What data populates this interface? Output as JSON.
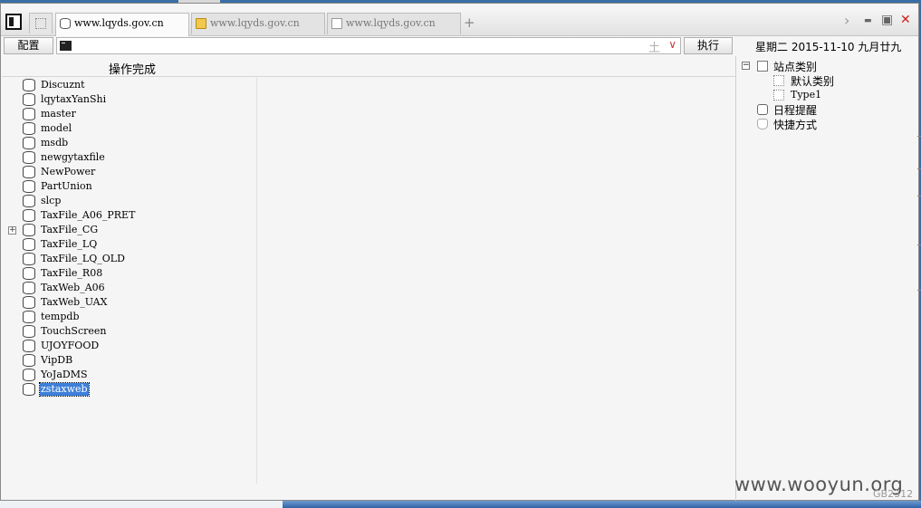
{
  "tabs": [
    {
      "title": "www.lqyds.gov.cn",
      "icon": "database-icon",
      "active": true
    },
    {
      "title": "www.lqyds.gov.cn",
      "icon": "folder-icon",
      "active": false
    },
    {
      "title": "www.lqyds.gov.cn",
      "icon": "page-icon",
      "active": false
    }
  ],
  "tabbar": {
    "new_tab": "+",
    "scroll_right": "›",
    "minimize": "▬",
    "maximize": "▣",
    "close": "✕"
  },
  "toolbar": {
    "config_label": "配置",
    "command_value": "",
    "plus_glyph": "土",
    "dropdown_glyph": "∨",
    "execute_label": "执行",
    "date_text": "星期二 2015-11-10 九月廿九"
  },
  "status": {
    "message": "操作完成"
  },
  "databases": [
    {
      "name": "Discuznt"
    },
    {
      "name": "lqytaxYanShi"
    },
    {
      "name": "master"
    },
    {
      "name": "model"
    },
    {
      "name": "msdb"
    },
    {
      "name": "newgytaxfile"
    },
    {
      "name": "NewPower"
    },
    {
      "name": "PartUnion"
    },
    {
      "name": "slcp"
    },
    {
      "name": "TaxFile_A06_PRET"
    },
    {
      "name": "TaxFile_CG",
      "expander": "+"
    },
    {
      "name": "TaxFile_LQ"
    },
    {
      "name": "TaxFile_LQ_OLD"
    },
    {
      "name": "TaxFile_R08"
    },
    {
      "name": "TaxWeb_A06"
    },
    {
      "name": "TaxWeb_UAX"
    },
    {
      "name": "tempdb"
    },
    {
      "name": "TouchScreen"
    },
    {
      "name": "UJOYFOOD"
    },
    {
      "name": "VipDB"
    },
    {
      "name": "YoJaDMS"
    },
    {
      "name": "zstaxweb",
      "selected": true
    }
  ],
  "site_tree": {
    "root": {
      "label": "站点类别",
      "expander": "−"
    },
    "children": [
      {
        "label": "默认类别"
      },
      {
        "label": "Type1"
      }
    ],
    "schedule": {
      "label": "日程提醒"
    },
    "shortcuts": {
      "label": "快捷方式"
    }
  },
  "watermark": "www.wooyun.org",
  "encoding": "GB2312",
  "colors": {
    "selection": "#3d7fd9",
    "close_button": "#d12020",
    "desktop": "#3a6ea5"
  }
}
